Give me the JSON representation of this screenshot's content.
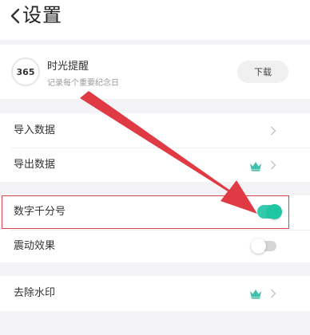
{
  "header": {
    "title": "设置"
  },
  "ad": {
    "logo_text": "365",
    "name": "时光提醒",
    "description": "记录每个重要纪念日",
    "button_label": "下载"
  },
  "settings": {
    "import_label": "导入数据",
    "export_label": "导出数据",
    "thousands_label": "数字千分号",
    "thousands_on": true,
    "vibration_label": "震动效果",
    "vibration_on": false,
    "watermark_label": "去除水印"
  },
  "colors": {
    "toggle_on": "#33c9ad",
    "crown": "#3fbfa6",
    "annotation_red": "#e03a45"
  },
  "icons": [
    "back-chevron-icon",
    "chevron-right-icon",
    "crown-icon"
  ]
}
